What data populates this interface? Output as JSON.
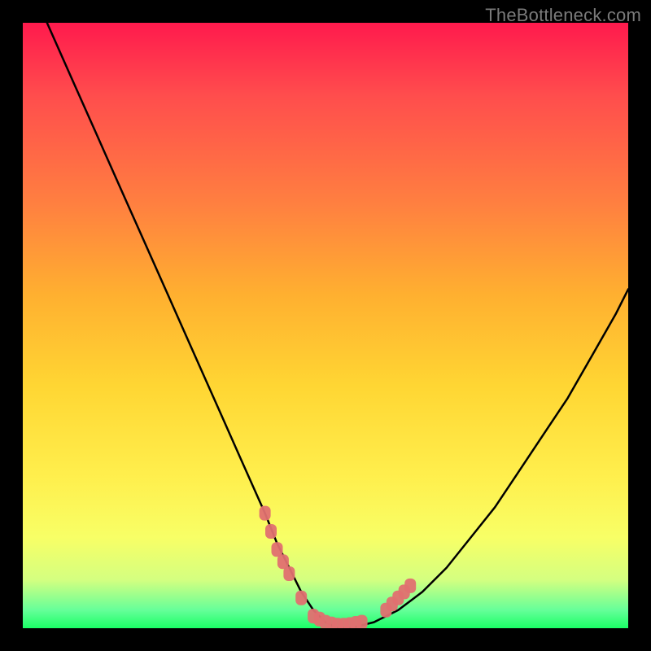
{
  "watermark": {
    "text": "TheBottleneck.com"
  },
  "chart_data": {
    "type": "line",
    "title": "",
    "xlabel": "",
    "ylabel": "",
    "xlim": [
      0,
      100
    ],
    "ylim": [
      0,
      100
    ],
    "grid": false,
    "legend": false,
    "series": [
      {
        "name": "bottleneck-curve",
        "x": [
          4,
          8,
          12,
          16,
          20,
          24,
          28,
          32,
          36,
          40,
          42,
          44,
          46,
          48,
          50,
          52,
          54,
          58,
          62,
          66,
          70,
          74,
          78,
          82,
          86,
          90,
          94,
          98,
          100
        ],
        "values": [
          100,
          91,
          82,
          73,
          64,
          55,
          46,
          37,
          28,
          19,
          14,
          10,
          6,
          3,
          1,
          0,
          0,
          1,
          3,
          6,
          10,
          15,
          20,
          26,
          32,
          38,
          45,
          52,
          56
        ]
      }
    ],
    "markers": {
      "name": "highlighted-points",
      "color": "#e07070",
      "x": [
        40,
        41,
        42,
        43,
        44,
        46,
        48,
        49,
        50,
        51,
        52,
        53,
        54,
        55,
        56,
        60,
        61,
        62,
        63,
        64
      ],
      "values": [
        19,
        16,
        13,
        11,
        9,
        5,
        2,
        1.5,
        1,
        0.7,
        0.5,
        0.5,
        0.6,
        0.8,
        1,
        3,
        4,
        5,
        6,
        7
      ]
    }
  }
}
